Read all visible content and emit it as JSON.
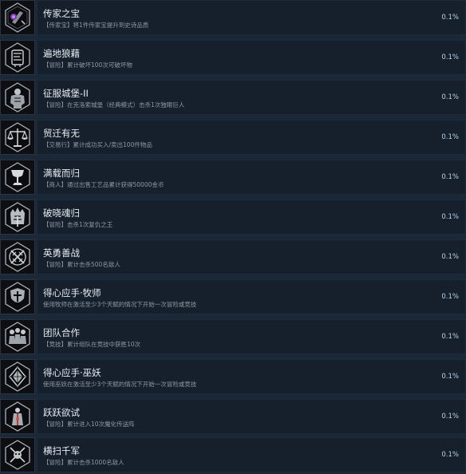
{
  "achievements": [
    {
      "title": "传家之宝",
      "desc": "【传家宝】将1件传家宝提升到史诗品质",
      "percent": "0.1%",
      "icon": "heirloom-icon"
    },
    {
      "title": "遍地狼藉",
      "desc": "【冒险】累计破坏100次可破坏物",
      "percent": "0.1%",
      "icon": "destruction-icon"
    },
    {
      "title": "征服城堡-II",
      "desc": "【冒险】在克洛索城堡（经典模式）击杀1次独眼巨人",
      "percent": "0.1%",
      "icon": "cyclops-icon"
    },
    {
      "title": "贸迁有无",
      "desc": "【交易行】累计成功买入/卖出100件物品",
      "percent": "0.1%",
      "icon": "scales-icon"
    },
    {
      "title": "满载而归",
      "desc": "【商人】通过出售工艺品累计获得50000金币",
      "percent": "0.1%",
      "icon": "goblet-icon"
    },
    {
      "title": "破晓魂归",
      "desc": "【冒险】击杀1次复仇之王",
      "percent": "0.1%",
      "icon": "crown-icon"
    },
    {
      "title": "英勇善战",
      "desc": "【冒险】累计击杀500名敌人",
      "percent": "0.1%",
      "icon": "crossed-swords-icon"
    },
    {
      "title": "得心应手·牧师",
      "desc": "使用牧师在激活至少3个天赋的情况下开始一次冒险或竞技",
      "percent": "0.1%",
      "icon": "cleric-shield-icon"
    },
    {
      "title": "团队合作",
      "desc": "【竞技】累计组队在竞技中获胜10次",
      "percent": "0.1%",
      "icon": "team-icon"
    },
    {
      "title": "得心应手·巫妖",
      "desc": "使用巫妖在激活至少3个天赋的情况下开始一次冒险或竞技",
      "percent": "0.1%",
      "icon": "lich-icon"
    },
    {
      "title": "跃跃欲试",
      "desc": "【冒险】累计进入10次魔化传送阵",
      "percent": "0.1%",
      "icon": "portal-icon"
    },
    {
      "title": "横扫千军",
      "desc": "【冒险】累计击杀1000名敌人",
      "percent": "0.1%",
      "icon": "skull-swords-icon"
    }
  ]
}
